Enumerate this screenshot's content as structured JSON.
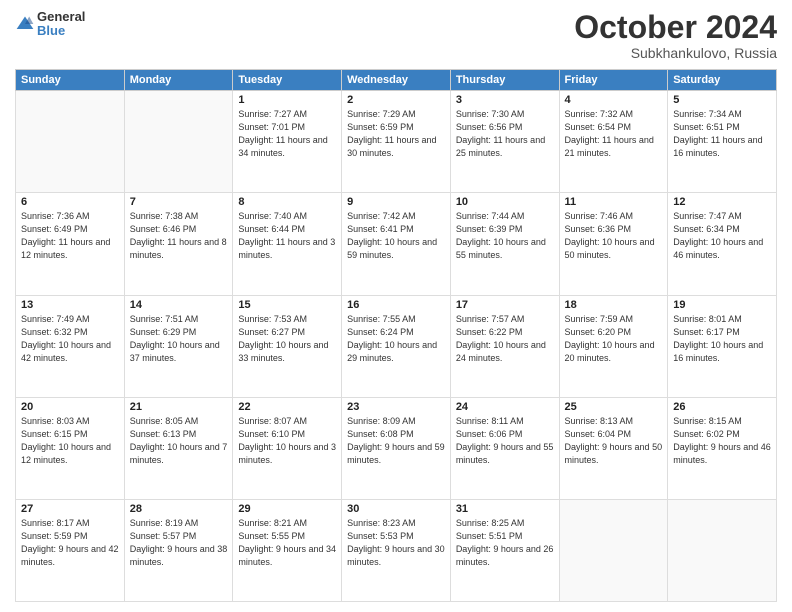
{
  "logo": {
    "general": "General",
    "blue": "Blue"
  },
  "title": {
    "month": "October 2024",
    "location": "Subkhankulovo, Russia"
  },
  "headers": [
    "Sunday",
    "Monday",
    "Tuesday",
    "Wednesday",
    "Thursday",
    "Friday",
    "Saturday"
  ],
  "weeks": [
    [
      {
        "day": "",
        "sunrise": "",
        "sunset": "",
        "daylight": ""
      },
      {
        "day": "",
        "sunrise": "",
        "sunset": "",
        "daylight": ""
      },
      {
        "day": "1",
        "sunrise": "Sunrise: 7:27 AM",
        "sunset": "Sunset: 7:01 PM",
        "daylight": "Daylight: 11 hours and 34 minutes."
      },
      {
        "day": "2",
        "sunrise": "Sunrise: 7:29 AM",
        "sunset": "Sunset: 6:59 PM",
        "daylight": "Daylight: 11 hours and 30 minutes."
      },
      {
        "day": "3",
        "sunrise": "Sunrise: 7:30 AM",
        "sunset": "Sunset: 6:56 PM",
        "daylight": "Daylight: 11 hours and 25 minutes."
      },
      {
        "day": "4",
        "sunrise": "Sunrise: 7:32 AM",
        "sunset": "Sunset: 6:54 PM",
        "daylight": "Daylight: 11 hours and 21 minutes."
      },
      {
        "day": "5",
        "sunrise": "Sunrise: 7:34 AM",
        "sunset": "Sunset: 6:51 PM",
        "daylight": "Daylight: 11 hours and 16 minutes."
      }
    ],
    [
      {
        "day": "6",
        "sunrise": "Sunrise: 7:36 AM",
        "sunset": "Sunset: 6:49 PM",
        "daylight": "Daylight: 11 hours and 12 minutes."
      },
      {
        "day": "7",
        "sunrise": "Sunrise: 7:38 AM",
        "sunset": "Sunset: 6:46 PM",
        "daylight": "Daylight: 11 hours and 8 minutes."
      },
      {
        "day": "8",
        "sunrise": "Sunrise: 7:40 AM",
        "sunset": "Sunset: 6:44 PM",
        "daylight": "Daylight: 11 hours and 3 minutes."
      },
      {
        "day": "9",
        "sunrise": "Sunrise: 7:42 AM",
        "sunset": "Sunset: 6:41 PM",
        "daylight": "Daylight: 10 hours and 59 minutes."
      },
      {
        "day": "10",
        "sunrise": "Sunrise: 7:44 AM",
        "sunset": "Sunset: 6:39 PM",
        "daylight": "Daylight: 10 hours and 55 minutes."
      },
      {
        "day": "11",
        "sunrise": "Sunrise: 7:46 AM",
        "sunset": "Sunset: 6:36 PM",
        "daylight": "Daylight: 10 hours and 50 minutes."
      },
      {
        "day": "12",
        "sunrise": "Sunrise: 7:47 AM",
        "sunset": "Sunset: 6:34 PM",
        "daylight": "Daylight: 10 hours and 46 minutes."
      }
    ],
    [
      {
        "day": "13",
        "sunrise": "Sunrise: 7:49 AM",
        "sunset": "Sunset: 6:32 PM",
        "daylight": "Daylight: 10 hours and 42 minutes."
      },
      {
        "day": "14",
        "sunrise": "Sunrise: 7:51 AM",
        "sunset": "Sunset: 6:29 PM",
        "daylight": "Daylight: 10 hours and 37 minutes."
      },
      {
        "day": "15",
        "sunrise": "Sunrise: 7:53 AM",
        "sunset": "Sunset: 6:27 PM",
        "daylight": "Daylight: 10 hours and 33 minutes."
      },
      {
        "day": "16",
        "sunrise": "Sunrise: 7:55 AM",
        "sunset": "Sunset: 6:24 PM",
        "daylight": "Daylight: 10 hours and 29 minutes."
      },
      {
        "day": "17",
        "sunrise": "Sunrise: 7:57 AM",
        "sunset": "Sunset: 6:22 PM",
        "daylight": "Daylight: 10 hours and 24 minutes."
      },
      {
        "day": "18",
        "sunrise": "Sunrise: 7:59 AM",
        "sunset": "Sunset: 6:20 PM",
        "daylight": "Daylight: 10 hours and 20 minutes."
      },
      {
        "day": "19",
        "sunrise": "Sunrise: 8:01 AM",
        "sunset": "Sunset: 6:17 PM",
        "daylight": "Daylight: 10 hours and 16 minutes."
      }
    ],
    [
      {
        "day": "20",
        "sunrise": "Sunrise: 8:03 AM",
        "sunset": "Sunset: 6:15 PM",
        "daylight": "Daylight: 10 hours and 12 minutes."
      },
      {
        "day": "21",
        "sunrise": "Sunrise: 8:05 AM",
        "sunset": "Sunset: 6:13 PM",
        "daylight": "Daylight: 10 hours and 7 minutes."
      },
      {
        "day": "22",
        "sunrise": "Sunrise: 8:07 AM",
        "sunset": "Sunset: 6:10 PM",
        "daylight": "Daylight: 10 hours and 3 minutes."
      },
      {
        "day": "23",
        "sunrise": "Sunrise: 8:09 AM",
        "sunset": "Sunset: 6:08 PM",
        "daylight": "Daylight: 9 hours and 59 minutes."
      },
      {
        "day": "24",
        "sunrise": "Sunrise: 8:11 AM",
        "sunset": "Sunset: 6:06 PM",
        "daylight": "Daylight: 9 hours and 55 minutes."
      },
      {
        "day": "25",
        "sunrise": "Sunrise: 8:13 AM",
        "sunset": "Sunset: 6:04 PM",
        "daylight": "Daylight: 9 hours and 50 minutes."
      },
      {
        "day": "26",
        "sunrise": "Sunrise: 8:15 AM",
        "sunset": "Sunset: 6:02 PM",
        "daylight": "Daylight: 9 hours and 46 minutes."
      }
    ],
    [
      {
        "day": "27",
        "sunrise": "Sunrise: 8:17 AM",
        "sunset": "Sunset: 5:59 PM",
        "daylight": "Daylight: 9 hours and 42 minutes."
      },
      {
        "day": "28",
        "sunrise": "Sunrise: 8:19 AM",
        "sunset": "Sunset: 5:57 PM",
        "daylight": "Daylight: 9 hours and 38 minutes."
      },
      {
        "day": "29",
        "sunrise": "Sunrise: 8:21 AM",
        "sunset": "Sunset: 5:55 PM",
        "daylight": "Daylight: 9 hours and 34 minutes."
      },
      {
        "day": "30",
        "sunrise": "Sunrise: 8:23 AM",
        "sunset": "Sunset: 5:53 PM",
        "daylight": "Daylight: 9 hours and 30 minutes."
      },
      {
        "day": "31",
        "sunrise": "Sunrise: 8:25 AM",
        "sunset": "Sunset: 5:51 PM",
        "daylight": "Daylight: 9 hours and 26 minutes."
      },
      {
        "day": "",
        "sunrise": "",
        "sunset": "",
        "daylight": ""
      },
      {
        "day": "",
        "sunrise": "",
        "sunset": "",
        "daylight": ""
      }
    ]
  ]
}
